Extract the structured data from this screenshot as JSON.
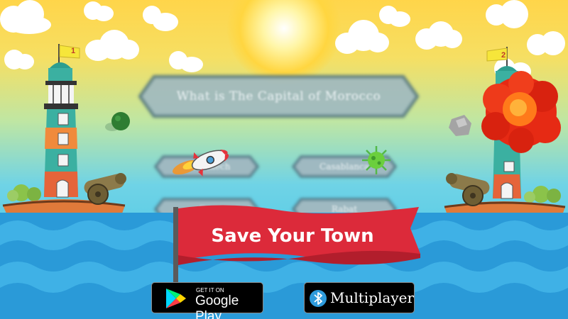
{
  "game": {
    "question": "What is The Capital of Morocco",
    "answers": [
      {
        "label": "Marrakech"
      },
      {
        "label": "Casablanca"
      },
      {
        "label": "Fes"
      },
      {
        "label": "Rabat"
      }
    ],
    "banner_title": "Save Your Town",
    "player_left_number": "1",
    "player_right_number": "2"
  },
  "store_button": {
    "small_text": "GET IT ON",
    "big_text": "Google Play"
  },
  "multiplayer_button": {
    "label": "Multiplayer"
  },
  "colors": {
    "banner_red": "#dc2a3a",
    "sky_top": "#ffd54a",
    "sea": "#2fa9e0",
    "button_bg": "#000000"
  }
}
